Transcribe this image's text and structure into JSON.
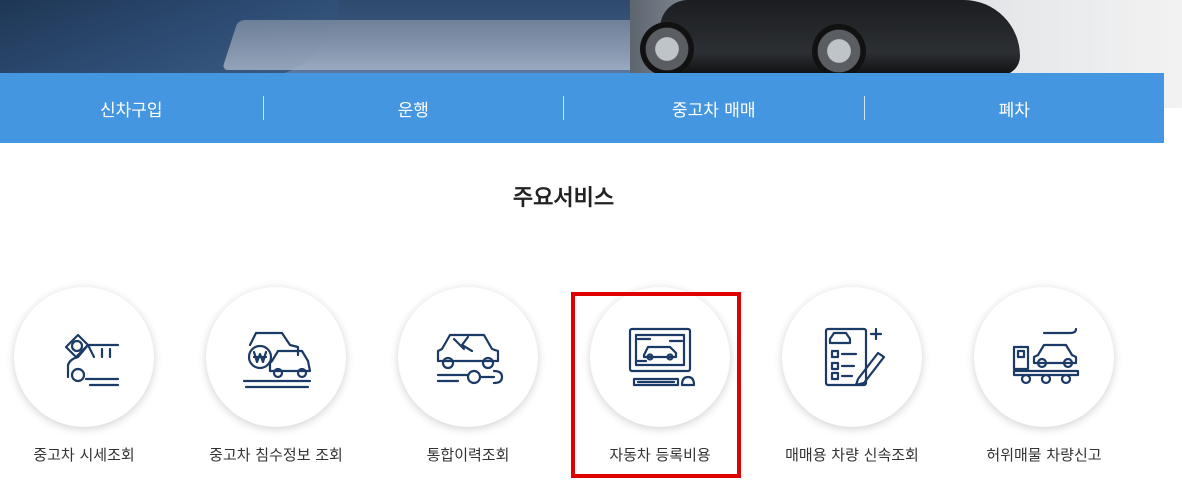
{
  "nav": {
    "items": [
      {
        "label": "신차구입"
      },
      {
        "label": "운행"
      },
      {
        "label": "중고차 매매"
      },
      {
        "label": "폐차"
      }
    ]
  },
  "section": {
    "title": "주요서비스"
  },
  "services": [
    {
      "label": "중고차 시세조회",
      "icon": "car-price-tag-icon"
    },
    {
      "label": "중고차 침수정보 조회",
      "icon": "flooded-car-won-icon"
    },
    {
      "label": "통합이력조회",
      "icon": "car-repair-history-icon"
    },
    {
      "label": "자동차 등록비용",
      "icon": "computer-car-registration-icon"
    },
    {
      "label": "매매용 차량 신속조회",
      "icon": "checklist-car-icon"
    },
    {
      "label": "허위매물 차량신고",
      "icon": "tow-truck-report-icon"
    }
  ],
  "colors": {
    "nav": "#4596e0",
    "icon": "#1c3a66",
    "highlight": "#e00000"
  }
}
